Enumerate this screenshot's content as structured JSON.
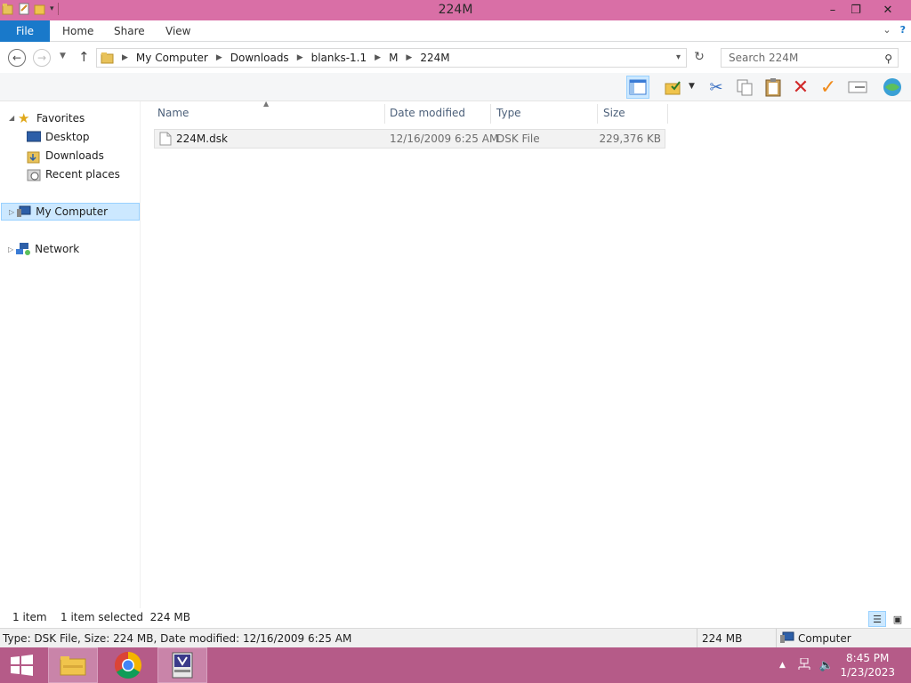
{
  "window": {
    "title": "224M",
    "min_label": "–",
    "restore_label": "❐",
    "close_label": "✕"
  },
  "ribbon": {
    "tabs": [
      "File",
      "Home",
      "Share",
      "View"
    ],
    "expand_glyph": "⌄",
    "help_glyph": "?"
  },
  "address": {
    "crumbs": [
      "My Computer",
      "Downloads",
      "blanks-1.1",
      "M",
      "224M"
    ],
    "search_placeholder": "Search 224M"
  },
  "nav": {
    "favorites_label": "Favorites",
    "desktop_label": "Desktop",
    "downloads_label": "Downloads",
    "recent_label": "Recent places",
    "computer_label": "My Computer",
    "network_label": "Network"
  },
  "columns": {
    "name": "Name",
    "date": "Date modified",
    "type": "Type",
    "size": "Size"
  },
  "files": [
    {
      "name": "224M.dsk",
      "date": "12/16/2009 6:25 AM",
      "type": "DSK File",
      "size": "229,376 KB"
    }
  ],
  "status": {
    "count": "1 item",
    "selection": "1 item selected  224 MB"
  },
  "details": {
    "text": "Type: DSK File, Size: 224 MB, Date modified: 12/16/2009 6:25 AM",
    "size": "224 MB",
    "location": "Computer"
  },
  "taskbar": {
    "time": "8:45 PM",
    "date": "1/23/2023"
  },
  "colors": {
    "titlebar": "#d96fa6",
    "taskbar": "#b55b88",
    "file_tab": "#1979ca",
    "selection": "#cce8ff"
  }
}
